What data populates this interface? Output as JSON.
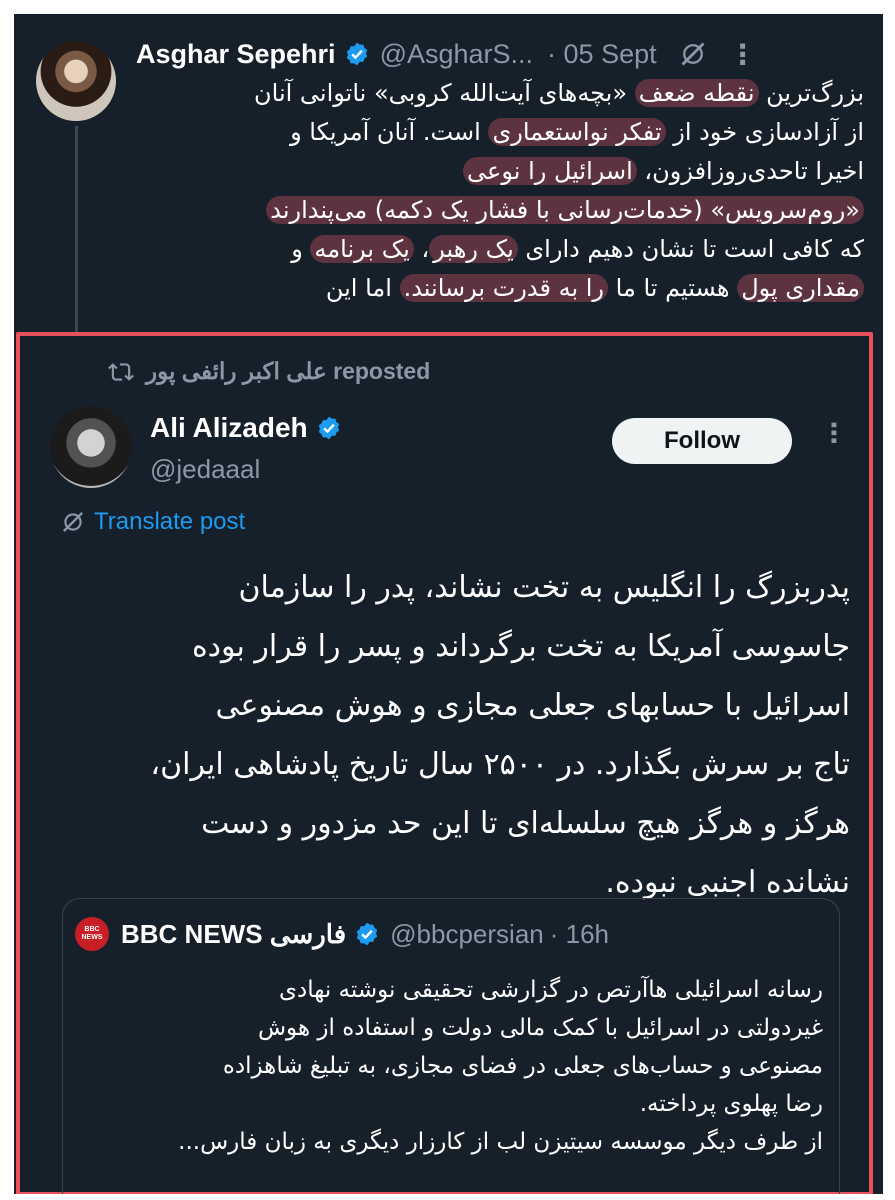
{
  "colors": {
    "background": "#15202b",
    "highlight": "#e95a68",
    "border": "#e8505b",
    "link": "#1d9bf0",
    "verified": "#1d9bf0",
    "muted": "#8b98a5"
  },
  "top_post": {
    "author_name": "Asghar Sepehri",
    "handle": "@AsgharS...",
    "date": "· 05 Sept",
    "icons": [
      "verified-icon",
      "grok-icon",
      "more-icon"
    ],
    "lines": [
      [
        {
          "t": "بزرگ‌ترین ",
          "h": false
        },
        {
          "t": "نقطه ضعف",
          "h": true
        },
        {
          "t": " «بچه‌های آیت‌الله کروبی» ناتوانی آنان",
          "h": false
        }
      ],
      [
        {
          "t": "از آزادسازی خود از ",
          "h": false
        },
        {
          "t": "تفکر نواستعماری",
          "h": true
        },
        {
          "t": " است. آنان آمریکا و",
          "h": false
        }
      ],
      [
        {
          "t": "اخیرا تاحدی‌روزافزون، ",
          "h": false
        },
        {
          "t": "اسرائیل را نوعی",
          "h": true
        }
      ],
      [
        {
          "t": "«روم‌سرویس» (خدمات‌رسانی با فشار یک دکمه) می‌پندارند",
          "h": true
        }
      ],
      [
        {
          "t": "که کافی است تا نشان دهیم دارای ",
          "h": false
        },
        {
          "t": "یک رهبر",
          "h": true
        },
        {
          "t": "، ",
          "h": false
        },
        {
          "t": "یک برنامه",
          "h": true
        },
        {
          "t": " و",
          "h": false
        }
      ],
      [
        {
          "t": "مقداری پول",
          "h": true
        },
        {
          "t": " هستیم تا ما ",
          "h": false
        },
        {
          "t": "را به قدرت برسانند.",
          "h": true
        },
        {
          "t": " اما این",
          "h": false
        }
      ]
    ]
  },
  "repost": {
    "reposter_label": "علی اکبر رائفی پور reposted",
    "author_name": "Ali Alizadeh",
    "handle": "@jedaaal",
    "follow_label": "Follow",
    "translate_label": "Translate post",
    "body_lines": [
      "پدربزرگ را انگلیس به تخت نشاند، پدر را سازمان",
      "جاسوسی آمریکا به تخت برگرداند و پسر را قرار بوده",
      "اسرائیل با حسابهای جعلی مجازی و هوش مصنوعی",
      "تاج بر سرش بگذارد. در ۲۵۰۰ سال تاریخ پادشاهی ایران،",
      "هرگز و هرگز هیچ سلسله‌ای تا این حد مزدور و دست",
      "نشانده اجنبی نبوده."
    ]
  },
  "quote": {
    "logo_text": [
      "BBC",
      "NEWS"
    ],
    "name": "BBC NEWS فارسی",
    "handle": "@bbcpersian",
    "time": "· 16h",
    "body_lines": [
      "رسانه اسرائیلی هاآرتص در گزارشی تحقیقی نوشته نهادی",
      "غیردولتی در اسرائیل با کمک مالی دولت و استفاده از هوش",
      "مصنوعی و حساب‌های جعلی در فضای مجازی، به تبلیغ شاهزاده",
      "رضا پهلوی پرداخته.",
      "از طرف دیگر موسسه سیتیزن لب از کارزار دیگری به زبان فارس..."
    ]
  }
}
